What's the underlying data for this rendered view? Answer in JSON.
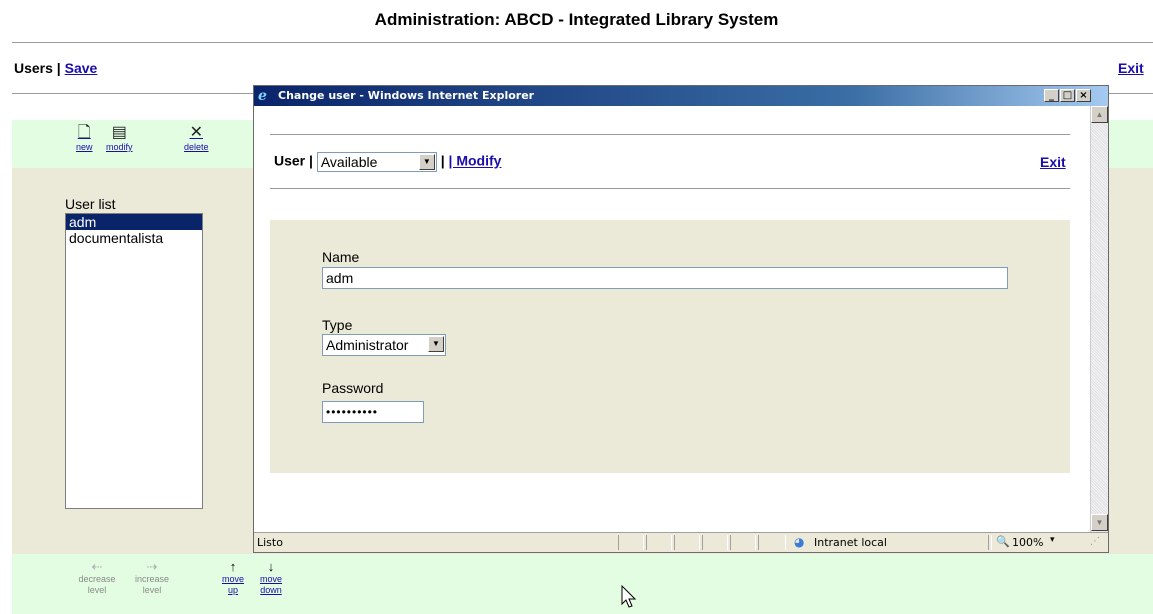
{
  "page": {
    "title": "Administration: ABCD - Integrated Library System",
    "users_label": "Users |",
    "save_label": "Save",
    "exit_label": "Exit"
  },
  "toolbar": {
    "new_label": "new",
    "modify_label": "modify",
    "delete_label": "delete",
    "new_icon": "document-icon",
    "modify_icon": "document-lines-icon",
    "delete_icon": "x-icon"
  },
  "user_list": {
    "label": "User list",
    "items": [
      "adm",
      "documentalista"
    ],
    "selected": "adm"
  },
  "bottom_toolbar": {
    "decrease_level": [
      "decrease",
      "level"
    ],
    "increase_level": [
      "increase",
      "level"
    ],
    "move_up": [
      "move",
      "up"
    ],
    "move_down": [
      "move",
      "down"
    ]
  },
  "dialog": {
    "title": "Change user - Windows Internet Explorer",
    "user_label": "User |",
    "user_select_value": "Available",
    "modify_label": "| Modify",
    "exit_label": "Exit",
    "form": {
      "name_label": "Name",
      "name_value": "adm",
      "type_label": "Type",
      "type_value": "Administrator",
      "password_label": "Password",
      "password_value": "••••••••••"
    },
    "status": {
      "text": "Listo",
      "zone": "Intranet local",
      "zoom": "100%"
    }
  },
  "colors": {
    "toolbar_bg": "#e2fde2",
    "panel_bg": "#ebe9d8",
    "link": "#1a0dab",
    "selection": "#0a246a"
  }
}
